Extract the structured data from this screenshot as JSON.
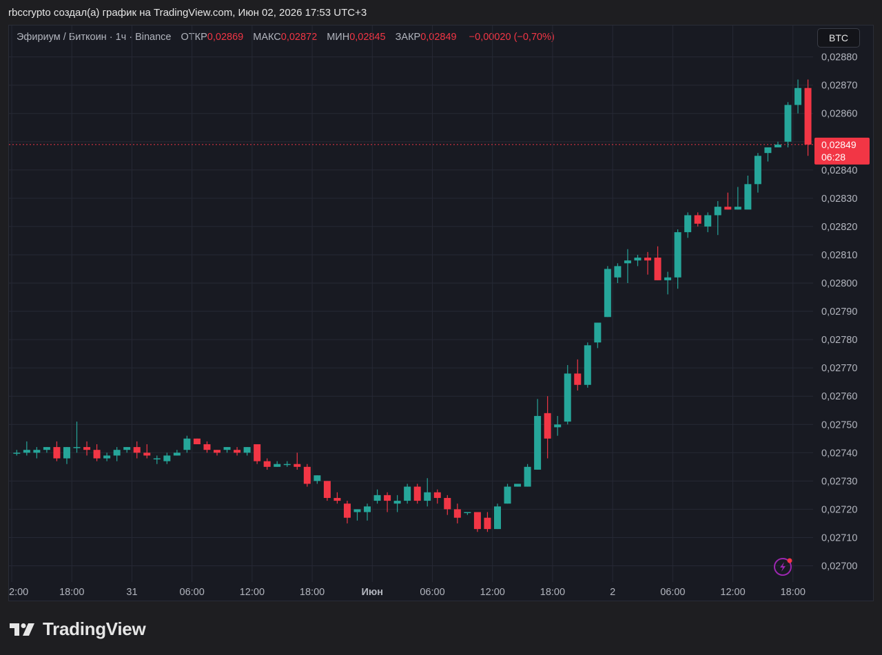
{
  "caption": "rbccrypto создал(а) график на TradingView.com, Июн 02, 2026 17:53 UTC+3",
  "legend": {
    "symbol": "Эфириум / Биткоин · 1ч · Binance",
    "open_label": "ОТКР",
    "open": "0,02869",
    "high_label": "МАКС",
    "high": "0,02872",
    "low_label": "МИН",
    "low": "0,02845",
    "close_label": "ЗАКР",
    "close": "0,02849",
    "change": "−0,00020 (−0,70%)"
  },
  "currency_button": "BTC",
  "price_tag": {
    "price": "0,02849",
    "countdown": "06:28"
  },
  "brand": "TradingView",
  "colors": {
    "up": "#26a69a",
    "down": "#f23645",
    "background": "#181a22",
    "grid": "#262935",
    "axis_text": "#b2b5be"
  },
  "icons": {
    "lightning": "lightning-icon",
    "logo": "tradingview-logo-icon"
  },
  "chart_data": {
    "type": "candlestick",
    "title": "Эфириум / Биткоин · 1ч · Binance",
    "ylim": [
      0.02697,
      0.02884
    ],
    "grid": true,
    "y_ticks": [
      {
        "value": 0.027,
        "label": "0,02700"
      },
      {
        "value": 0.0271,
        "label": "0,02710"
      },
      {
        "value": 0.0272,
        "label": "0,02720"
      },
      {
        "value": 0.0273,
        "label": "0,02730"
      },
      {
        "value": 0.0274,
        "label": "0,02740"
      },
      {
        "value": 0.0275,
        "label": "0,02750"
      },
      {
        "value": 0.0276,
        "label": "0,02760"
      },
      {
        "value": 0.0277,
        "label": "0,02770"
      },
      {
        "value": 0.0278,
        "label": "0,02780"
      },
      {
        "value": 0.0279,
        "label": "0,02790"
      },
      {
        "value": 0.028,
        "label": "0,02800"
      },
      {
        "value": 0.0281,
        "label": "0,02810"
      },
      {
        "value": 0.0282,
        "label": "0,02820"
      },
      {
        "value": 0.0283,
        "label": "0,02830"
      },
      {
        "value": 0.0284,
        "label": "0,02840"
      },
      {
        "value": 0.0285,
        "label": "0,02850"
      },
      {
        "value": 0.0286,
        "label": "0,02860"
      },
      {
        "value": 0.0287,
        "label": "0,02870"
      },
      {
        "value": 0.0288,
        "label": "0,02880"
      }
    ],
    "x_ticks": [
      {
        "index": -0.5,
        "label": "2:00"
      },
      {
        "index": 5.5,
        "label": "18:00"
      },
      {
        "index": 11.5,
        "label": "31"
      },
      {
        "index": 17.5,
        "label": "06:00"
      },
      {
        "index": 23.5,
        "label": "12:00"
      },
      {
        "index": 29.5,
        "label": "18:00"
      },
      {
        "index": 35.5,
        "label": "Июн",
        "bold": true
      },
      {
        "index": 41.5,
        "label": "06:00"
      },
      {
        "index": 47.5,
        "label": "12:00"
      },
      {
        "index": 53.5,
        "label": "18:00"
      },
      {
        "index": 59.5,
        "label": "2"
      },
      {
        "index": 65.5,
        "label": "06:00"
      },
      {
        "index": 71.5,
        "label": "12:00"
      },
      {
        "index": 77.5,
        "label": "18:00"
      }
    ],
    "last_price": 0.02849,
    "candles": [
      [
        0.0274,
        0.02741,
        0.02739,
        0.0274
      ],
      [
        0.0274,
        0.02744,
        0.02739,
        0.02741
      ],
      [
        0.0274,
        0.02742,
        0.02738,
        0.02741
      ],
      [
        0.02741,
        0.02742,
        0.0274,
        0.02742
      ],
      [
        0.02742,
        0.02744,
        0.02737,
        0.02738
      ],
      [
        0.02738,
        0.02742,
        0.02736,
        0.02742
      ],
      [
        0.02742,
        0.02751,
        0.0274,
        0.02742
      ],
      [
        0.02742,
        0.02744,
        0.02739,
        0.02741
      ],
      [
        0.02741,
        0.02743,
        0.02737,
        0.02738
      ],
      [
        0.02738,
        0.0274,
        0.02737,
        0.02739
      ],
      [
        0.02739,
        0.02742,
        0.02737,
        0.02741
      ],
      [
        0.02741,
        0.02742,
        0.0274,
        0.02742
      ],
      [
        0.02742,
        0.02744,
        0.02738,
        0.0274
      ],
      [
        0.0274,
        0.02743,
        0.02738,
        0.02739
      ],
      [
        0.02738,
        0.02739,
        0.02736,
        0.02738
      ],
      [
        0.02737,
        0.0274,
        0.02736,
        0.02739
      ],
      [
        0.02739,
        0.02741,
        0.02739,
        0.0274
      ],
      [
        0.02741,
        0.02746,
        0.0274,
        0.02745
      ],
      [
        0.02745,
        0.02745,
        0.02743,
        0.02743
      ],
      [
        0.02743,
        0.02744,
        0.0274,
        0.02741
      ],
      [
        0.02741,
        0.02741,
        0.02739,
        0.0274
      ],
      [
        0.02741,
        0.02742,
        0.0274,
        0.02742
      ],
      [
        0.02741,
        0.02742,
        0.02739,
        0.0274
      ],
      [
        0.0274,
        0.02742,
        0.02739,
        0.02742
      ],
      [
        0.02743,
        0.02743,
        0.02736,
        0.02737
      ],
      [
        0.02737,
        0.02738,
        0.02734,
        0.02735
      ],
      [
        0.02735,
        0.02737,
        0.02735,
        0.02736
      ],
      [
        0.02736,
        0.02737,
        0.02735,
        0.02736
      ],
      [
        0.02736,
        0.0274,
        0.02734,
        0.02735
      ],
      [
        0.02735,
        0.02736,
        0.02728,
        0.02729
      ],
      [
        0.0273,
        0.02732,
        0.02729,
        0.02732
      ],
      [
        0.0273,
        0.0273,
        0.02723,
        0.02724
      ],
      [
        0.02724,
        0.02726,
        0.02722,
        0.02723
      ],
      [
        0.02722,
        0.02723,
        0.02715,
        0.02717
      ],
      [
        0.02719,
        0.0272,
        0.02716,
        0.0272
      ],
      [
        0.02719,
        0.02722,
        0.02716,
        0.02721
      ],
      [
        0.02723,
        0.02727,
        0.02722,
        0.02725
      ],
      [
        0.02725,
        0.02726,
        0.02719,
        0.02723
      ],
      [
        0.02722,
        0.02725,
        0.02719,
        0.02723
      ],
      [
        0.02723,
        0.02729,
        0.02722,
        0.02728
      ],
      [
        0.02728,
        0.02729,
        0.02722,
        0.02723
      ],
      [
        0.02723,
        0.02731,
        0.02721,
        0.02726
      ],
      [
        0.02726,
        0.02727,
        0.02722,
        0.02724
      ],
      [
        0.02724,
        0.02725,
        0.02718,
        0.0272
      ],
      [
        0.0272,
        0.02722,
        0.02715,
        0.02717
      ],
      [
        0.02719,
        0.02719,
        0.02718,
        0.02719
      ],
      [
        0.02719,
        0.02719,
        0.02712,
        0.02713
      ],
      [
        0.02717,
        0.02719,
        0.02712,
        0.02713
      ],
      [
        0.02713,
        0.02722,
        0.02713,
        0.02721
      ],
      [
        0.02722,
        0.02729,
        0.02722,
        0.02728
      ],
      [
        0.02728,
        0.02729,
        0.02728,
        0.02729
      ],
      [
        0.02728,
        0.02736,
        0.02728,
        0.02735
      ],
      [
        0.02734,
        0.02759,
        0.02734,
        0.02753
      ],
      [
        0.02754,
        0.0276,
        0.02738,
        0.02745
      ],
      [
        0.02749,
        0.02753,
        0.02746,
        0.0275
      ],
      [
        0.02751,
        0.02771,
        0.0275,
        0.02768
      ],
      [
        0.02768,
        0.02773,
        0.02762,
        0.02764
      ],
      [
        0.02764,
        0.02779,
        0.02763,
        0.02778
      ],
      [
        0.02779,
        0.02786,
        0.02777,
        0.02786
      ],
      [
        0.02788,
        0.02806,
        0.02788,
        0.02805
      ],
      [
        0.02802,
        0.02807,
        0.028,
        0.02806
      ],
      [
        0.02807,
        0.02812,
        0.028,
        0.02808
      ],
      [
        0.02808,
        0.0281,
        0.02806,
        0.02809
      ],
      [
        0.02809,
        0.02811,
        0.02803,
        0.02808
      ],
      [
        0.02809,
        0.02813,
        0.02801,
        0.02801
      ],
      [
        0.02801,
        0.02804,
        0.02796,
        0.02802
      ],
      [
        0.02802,
        0.02819,
        0.02798,
        0.02818
      ],
      [
        0.02818,
        0.02825,
        0.02816,
        0.02824
      ],
      [
        0.02824,
        0.02825,
        0.0282,
        0.02821
      ],
      [
        0.0282,
        0.02825,
        0.02818,
        0.02824
      ],
      [
        0.02824,
        0.02829,
        0.02817,
        0.02827
      ],
      [
        0.02827,
        0.02832,
        0.02826,
        0.02826
      ],
      [
        0.02826,
        0.02834,
        0.02826,
        0.02827
      ],
      [
        0.02826,
        0.02838,
        0.02831,
        0.02835
      ],
      [
        0.02835,
        0.02846,
        0.02832,
        0.02845
      ],
      [
        0.02846,
        0.02848,
        0.02843,
        0.02848
      ],
      [
        0.02848,
        0.0285,
        0.02848,
        0.02849
      ],
      [
        0.0285,
        0.02864,
        0.02848,
        0.02863
      ],
      [
        0.02863,
        0.02872,
        0.0286,
        0.02869
      ],
      [
        0.02869,
        0.02872,
        0.02845,
        0.02849
      ]
    ]
  }
}
